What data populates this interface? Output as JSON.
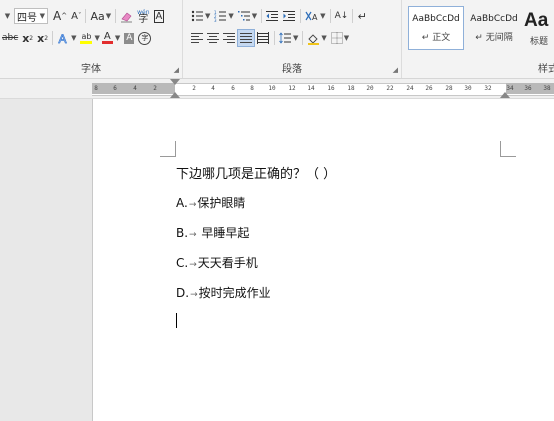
{
  "ribbon": {
    "font": {
      "size_value": "四号",
      "grow_label": "A",
      "shrink_label": "A",
      "case_label": "Aa",
      "phonetic_label": "wén",
      "phonetic_char": "字",
      "border_char": "A",
      "abc_label": "abc",
      "sub_label": "x",
      "sub_mark": "2",
      "sup_label": "x",
      "sup_mark": "2",
      "highlight_label": "ab",
      "fontcolor_label": "A",
      "shading_char": "A",
      "circle_char": "字",
      "group_label": "字体"
    },
    "paragraph": {
      "sort_label": "A↓",
      "group_label": "段落"
    },
    "styles": {
      "items": [
        {
          "sample": "AaBbCcDd",
          "name": "↵ 正文"
        },
        {
          "sample": "AaBbCcDd",
          "name": "↵ 无间隔"
        },
        {
          "sample": "Aa",
          "name": "标题"
        }
      ],
      "group_label": "样式"
    }
  },
  "ruler": {
    "left_numbers": [
      "8",
      "6",
      "4",
      "2"
    ],
    "right_numbers": [
      "2",
      "4",
      "6",
      "8",
      "10",
      "12",
      "14",
      "16",
      "18",
      "20",
      "22",
      "24",
      "26",
      "28",
      "30",
      "32",
      "34",
      "36",
      "38"
    ]
  },
  "document": {
    "question": "下边哪几项是正确的？（    ）",
    "options": [
      {
        "letter": "A.",
        "text": "保护眼睛"
      },
      {
        "letter": "B.",
        "text": " 早睡早起"
      },
      {
        "letter": "C.",
        "text": "天天看手机"
      },
      {
        "letter": "D.",
        "text": "按时完成作业"
      }
    ],
    "arrow_symbol": "→"
  }
}
